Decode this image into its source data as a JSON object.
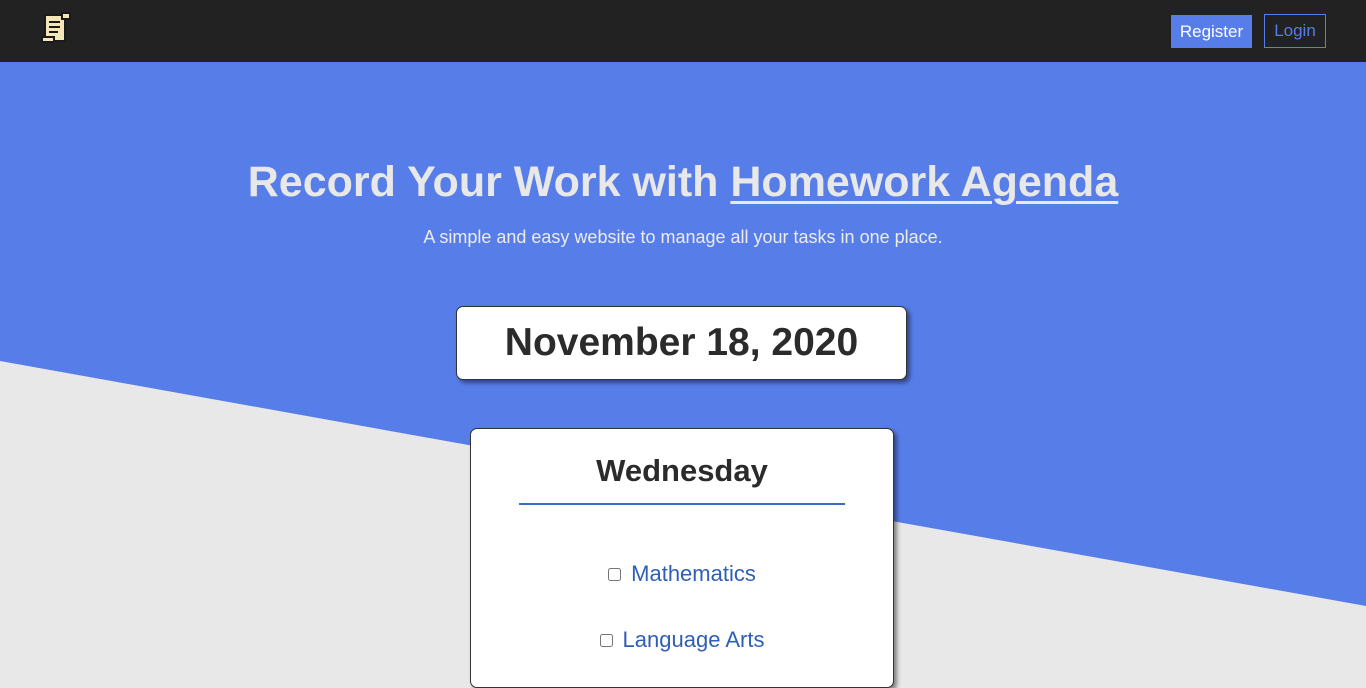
{
  "nav": {
    "register_label": "Register",
    "login_label": "Login"
  },
  "hero": {
    "title_prefix": "Record Your Work with ",
    "title_link": "Homework Agenda",
    "subtitle": "A simple and easy website to manage all your tasks in one place."
  },
  "date": "November 18, 2020",
  "day": {
    "name": "Wednesday",
    "tasks": [
      {
        "label": "Mathematics",
        "checked": false
      },
      {
        "label": "Language Arts",
        "checked": false
      }
    ]
  },
  "colors": {
    "navbar": "#222222",
    "accent": "#577de9",
    "background": "#e8e8e8",
    "task_link": "#2f5fb4"
  },
  "icons": {
    "logo": "scroll-document-icon"
  }
}
